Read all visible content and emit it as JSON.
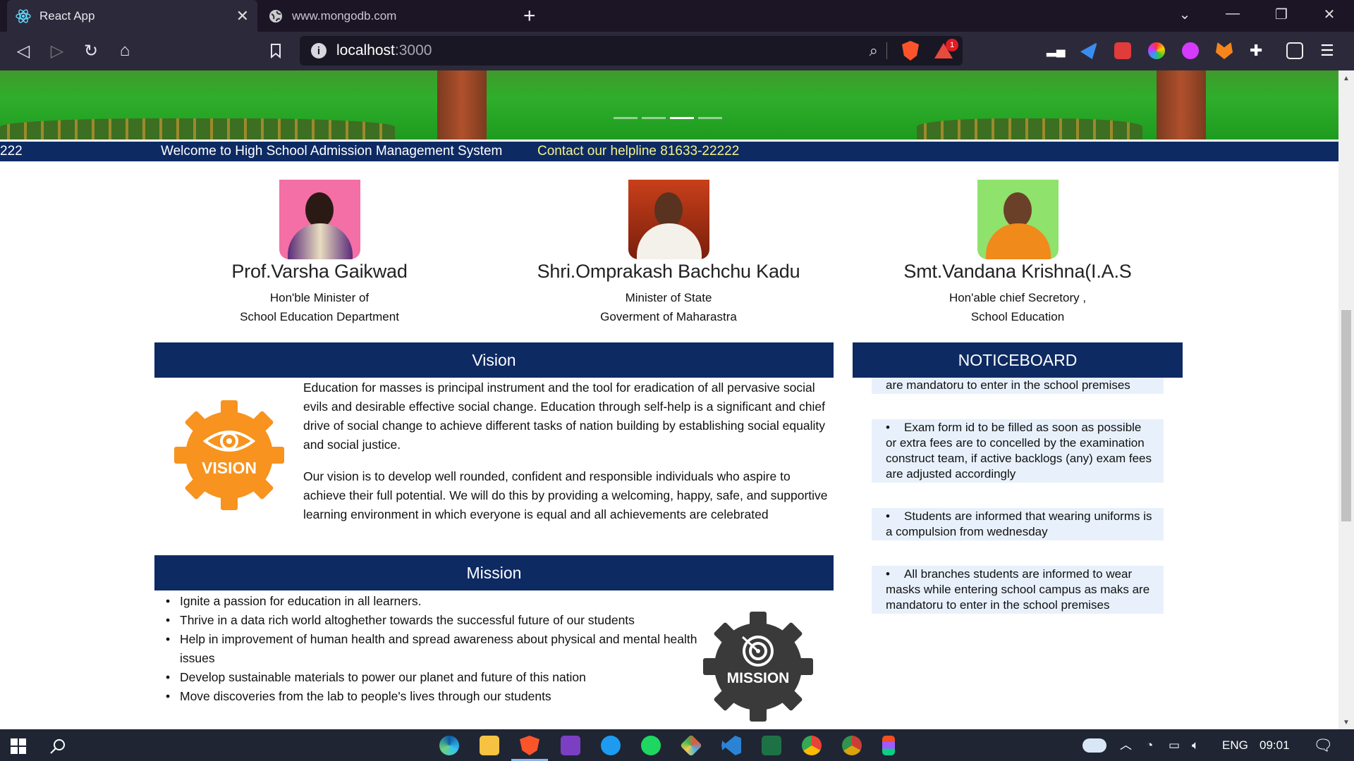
{
  "browser": {
    "tabs": [
      {
        "title": "React App",
        "active": true
      },
      {
        "title": "www.mongodb.com",
        "active": false
      }
    ],
    "url": {
      "host": "localhost",
      "port": ":3000"
    },
    "reward_count": "1"
  },
  "marquee": {
    "fragment": "222",
    "welcome": "Welcome to High School Admission Management System",
    "helpline": "Contact our helpline 81633-22222"
  },
  "leaders": [
    {
      "name": "Prof.Varsha Gaikwad",
      "role_line1": "Hon'ble Minister of",
      "role_line2": "School Education Department"
    },
    {
      "name": "Shri.Omprakash Bachchu Kadu",
      "role_line1": "Minister of State",
      "role_line2": "Goverment of Maharastra"
    },
    {
      "name": "Smt.Vandana Krishna(I.A.S",
      "role_line1": "Hon'able chief Secretory ,",
      "role_line2": "School Education"
    }
  ],
  "vision": {
    "heading": "Vision",
    "badge": "VISION",
    "paragraph1": "Education for masses is principal instrument and the tool for eradication of all pervasive social evils and desirable effective social change. Education through self-help is a significant and chief drive of social change to achieve different tasks of nation building by establishing social equality and social justice.",
    "paragraph2": "Our vision is to develop well rounded, confident and responsible individuals who aspire to achieve their full potential. We will do this by providing a welcoming, happy, safe, and supportive learning environment in which everyone is equal and all achievements are celebrated"
  },
  "mission": {
    "heading": "Mission",
    "badge": "MISSION",
    "items": [
      "Ignite a passion for education in all learners.",
      "Thrive in a data rich world altoghether towards the successful future of our students",
      "Help in improvement of human health and spread awareness about physical and mental health issues",
      "Develop sustainable materials to power our planet and future of this nation",
      "Move discoveries from the lab to people's lives through our students"
    ]
  },
  "noticeboard": {
    "heading": "NOTICEBOARD",
    "partial_top": "are mandatoru to enter in the school premises",
    "notices": [
      "Exam form id to be filled as soon as possible or extra fees are to concelled by the examination construct team, if active backlogs (any) exam fees are adjusted accordingly",
      "Students are informed that wearing uniforms is a compulsion from wednesday",
      "All branches students are informed to wear masks while entering school campus as maks are mandatoru to enter in the school premises"
    ]
  },
  "taskbar": {
    "language": "ENG",
    "time": "09:01"
  }
}
